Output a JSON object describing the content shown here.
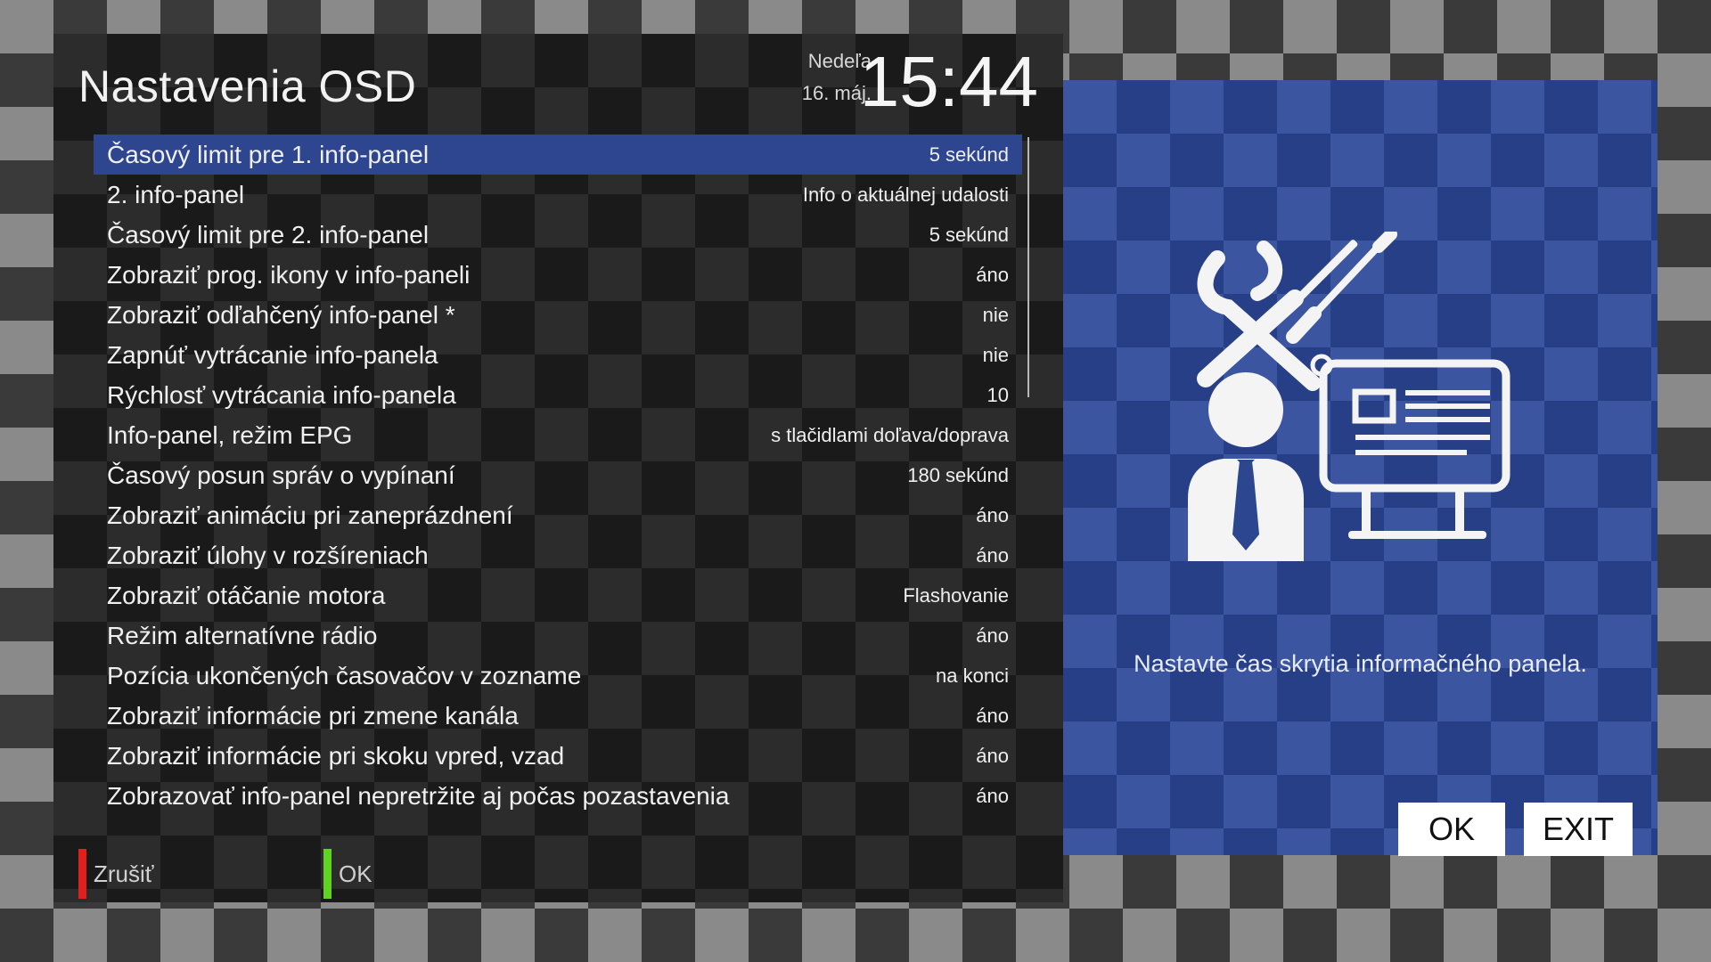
{
  "header": {
    "title": "Nastavenia OSD",
    "day": "Nedeľa",
    "date": "16. máj.",
    "time": "15:44"
  },
  "settings": [
    {
      "label": "Časový limit pre 1. info-panel",
      "value": "5 sekúnd",
      "selected": true
    },
    {
      "label": "2. info-panel",
      "value": "Info o aktuálnej udalosti"
    },
    {
      "label": "Časový limit pre 2. info-panel",
      "value": "5 sekúnd"
    },
    {
      "label": "Zobraziť prog. ikony v info-paneli",
      "value": "áno"
    },
    {
      "label": "Zobraziť odľahčený info-panel *",
      "value": "nie"
    },
    {
      "label": "Zapnúť vytrácanie info-panela",
      "value": "nie"
    },
    {
      "label": "Rýchlosť vytrácania info-panela",
      "value": "10"
    },
    {
      "label": "Info-panel, režim EPG",
      "value": "s tlačidlami doľava/doprava"
    },
    {
      "label": "Časový posun správ o vypínaní",
      "value": "180 sekúnd"
    },
    {
      "label": "Zobraziť animáciu pri zaneprázdnení",
      "value": "áno"
    },
    {
      "label": "Zobraziť úlohy v rozšíreniach",
      "value": "áno"
    },
    {
      "label": "Zobraziť otáčanie motora",
      "value": "Flashovanie"
    },
    {
      "label": "Režim alternatívne rádio",
      "value": "áno"
    },
    {
      "label": "Pozícia ukončených časovačov v zozname",
      "value": "na konci"
    },
    {
      "label": "Zobraziť informácie pri zmene kanála",
      "value": "áno"
    },
    {
      "label": "Zobraziť informácie pri skoku vpred, vzad",
      "value": "áno"
    },
    {
      "label": "Zobrazovať info-panel nepretržite aj počas pozastavenia",
      "value": "áno"
    }
  ],
  "footer": {
    "red_label": "Zrušiť",
    "green_label": "OK",
    "red_color": "#e0201c",
    "green_color": "#5fd31f"
  },
  "info": {
    "illustration_icon": "settings-user-monitor-icon",
    "help_text": "Nastavte čas skrytia informačného panela.",
    "ok_label": "OK",
    "exit_label": "EXIT"
  },
  "colors": {
    "selection": "#2e4690",
    "info_panel": "#2c4690"
  }
}
